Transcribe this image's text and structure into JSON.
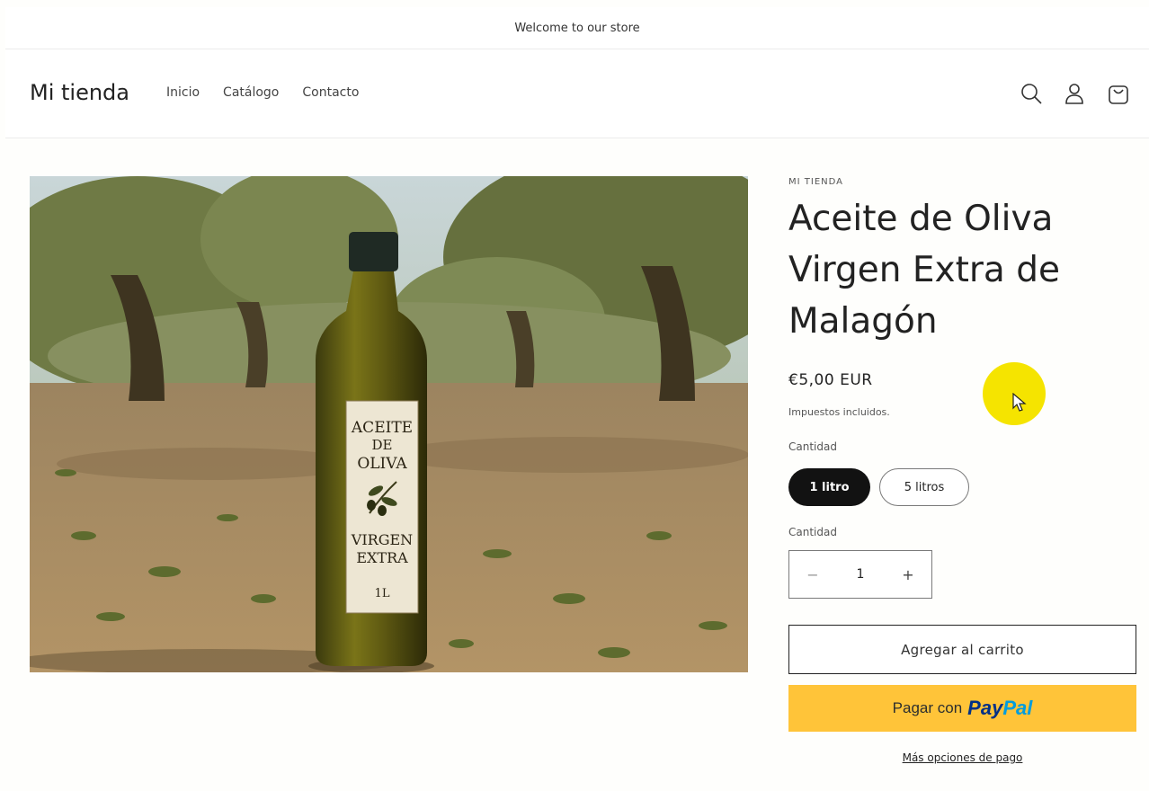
{
  "announcement": "Welcome to our store",
  "header": {
    "logo": "Mi tienda",
    "nav": [
      "Inicio",
      "Catálogo",
      "Contacto"
    ],
    "icons": [
      "search-icon",
      "account-icon",
      "cart-icon"
    ]
  },
  "product": {
    "vendor": "MI TIENDA",
    "title": "Aceite de Oliva Virgen Extra de Malagón",
    "price": "€5,00 EUR",
    "tax_note": "Impuestos incluidos.",
    "variant_label": "Cantidad",
    "variants": [
      "1 litro",
      "5 litros"
    ],
    "selected_variant": "1 litro",
    "quantity_label": "Cantidad",
    "quantity": "1",
    "add_to_cart": "Agregar al carrito",
    "paypal_prefix": "Pagar con",
    "paypal_brand_1": "Pay",
    "paypal_brand_2": "Pal",
    "more_payment": "Más opciones de pago"
  },
  "bottle_label": {
    "line1": "ACEITE",
    "line2": "DE",
    "line3": "OLIVA",
    "line4": "VIRGEN",
    "line5": "EXTRA",
    "volume": "1L"
  },
  "colors": {
    "paypal_yellow": "#ffc439",
    "paypal_dark_blue": "#003087",
    "paypal_light_blue": "#009cde",
    "selected_pill": "#121212",
    "cursor_highlight": "#f5e400"
  }
}
